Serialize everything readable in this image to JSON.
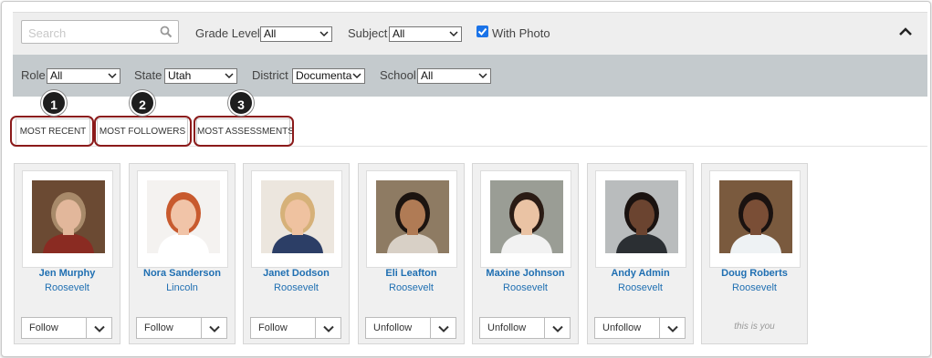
{
  "filters": {
    "search_placeholder": "Search",
    "grade_label": "Grade Level",
    "grade_value": "All",
    "subject_label": "Subject",
    "subject_value": "All",
    "with_photo_label": "With Photo",
    "with_photo_checked": true,
    "role_label": "Role",
    "role_value": "All",
    "state_label": "State",
    "state_value": "Utah",
    "district_label": "District",
    "district_value": "Documenta",
    "school_label": "School",
    "school_value": "All"
  },
  "tabs": [
    {
      "label": "MOST RECENT",
      "badge": "1"
    },
    {
      "label": "MOST FOLLOWERS",
      "badge": "2"
    },
    {
      "label": "MOST ASSESSMENTS",
      "badge": "3"
    }
  ],
  "people": [
    {
      "name": "Jen Murphy",
      "school": "Roosevelt",
      "action": "Follow",
      "bg": "#6b4a33",
      "skin": "#e2b79b",
      "hair": "#a88a6a",
      "shirt": "#8a2b22"
    },
    {
      "name": "Nora Sanderson",
      "school": "Lincoln",
      "action": "Follow",
      "bg": "#f4f2f0",
      "skin": "#f1c4a8",
      "hair": "#c85a2e",
      "shirt": "#ffffff"
    },
    {
      "name": "Janet Dodson",
      "school": "Roosevelt",
      "action": "Follow",
      "bg": "#ece6de",
      "skin": "#efc2a0",
      "hair": "#d6b179",
      "shirt": "#2c3e66"
    },
    {
      "name": "Eli Leafton",
      "school": "Roosevelt",
      "action": "Unfollow",
      "bg": "#8e7b63",
      "skin": "#b07b55",
      "hair": "#1c1410",
      "shirt": "#d8d0c6"
    },
    {
      "name": "Maxine Johnson",
      "school": "Roosevelt",
      "action": "Unfollow",
      "bg": "#9a9d95",
      "skin": "#eac3a4",
      "hair": "#2a1b14",
      "shirt": "#f2f2f2"
    },
    {
      "name": "Andy Admin",
      "school": "Roosevelt",
      "action": "Unfollow",
      "bg": "#b9bcbd",
      "skin": "#6b4430",
      "hair": "#1a1210",
      "shirt": "#2b2f33"
    },
    {
      "name": "Doug Roberts",
      "school": "Roosevelt",
      "action": "",
      "self_note": "this is you",
      "bg": "#7a5a3e",
      "skin": "#7a4e36",
      "hair": "#1a1210",
      "shirt": "#eef2f4"
    }
  ]
}
